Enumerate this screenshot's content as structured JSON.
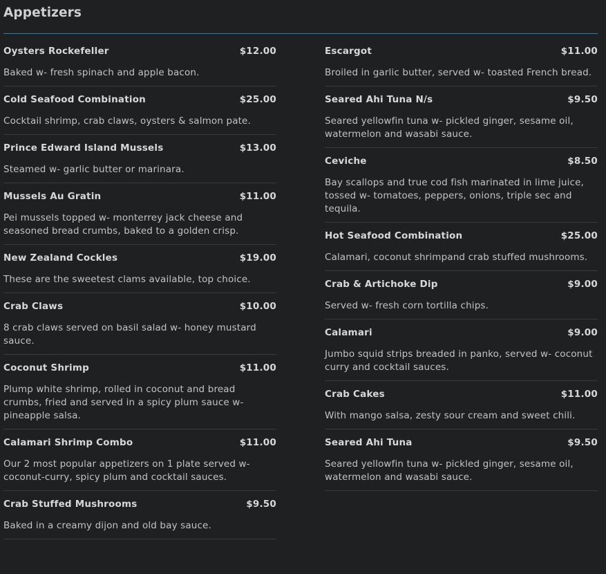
{
  "section": {
    "title": "Appetizers"
  },
  "colors": {
    "background": "#1f2022",
    "accent_rule": "#2f7fb3",
    "text": "#c9c9c9"
  },
  "left_items": [
    {
      "name": "Oysters Rockefeller",
      "price": "$12.00",
      "description": "Baked w- fresh spinach and apple bacon."
    },
    {
      "name": "Cold Seafood Combination",
      "price": "$25.00",
      "description": "Cocktail shrimp, crab claws, oysters & salmon pate."
    },
    {
      "name": "Prince Edward Island Mussels",
      "price": "$13.00",
      "description": "Steamed w- garlic butter or marinara."
    },
    {
      "name": "Mussels Au Gratin",
      "price": "$11.00",
      "description": "Pei mussels topped w- monterrey jack cheese and seasoned bread crumbs, baked to a golden crisp."
    },
    {
      "name": "New Zealand Cockles",
      "price": "$19.00",
      "description": "These are the sweetest clams available, top choice."
    },
    {
      "name": "Crab Claws",
      "price": "$10.00",
      "description": "8 crab claws served on basil salad w- honey mustard sauce."
    },
    {
      "name": "Coconut Shrimp",
      "price": "$11.00",
      "description": "Plump white shrimp, rolled in coconut and bread crumbs, fried and served in a spicy plum sauce w- pineapple salsa."
    },
    {
      "name": "Calamari Shrimp Combo",
      "price": "$11.00",
      "description": "Our 2 most popular appetizers on 1 plate served w- coconut-curry, spicy plum and cocktail sauces."
    },
    {
      "name": "Crab Stuffed Mushrooms",
      "price": "$9.50",
      "description": "Baked in a creamy dijon and old bay sauce."
    }
  ],
  "right_items": [
    {
      "name": "Escargot",
      "price": "$11.00",
      "description": "Broiled in garlic butter, served w- toasted French bread."
    },
    {
      "name": "Seared Ahi Tuna N/s",
      "price": "$9.50",
      "description": "Seared yellowfin tuna w- pickled ginger, sesame oil, watermelon and wasabi sauce."
    },
    {
      "name": "Ceviche",
      "price": "$8.50",
      "description": "Bay scallops and true cod fish marinated in lime juice, tossed w- tomatoes, peppers, onions, triple sec and tequila."
    },
    {
      "name": "Hot Seafood Combination",
      "price": "$25.00",
      "description": "Calamari, coconut shrimpand crab stuffed mushrooms."
    },
    {
      "name": "Crab & Artichoke Dip",
      "price": "$9.00",
      "description": "Served w- fresh corn tortilla chips."
    },
    {
      "name": "Calamari",
      "price": "$9.00",
      "description": "Jumbo squid strips breaded in panko, served w- coconut curry and cocktail sauces."
    },
    {
      "name": "Crab Cakes",
      "price": "$11.00",
      "description": "With mango salsa, zesty sour cream and sweet chili."
    },
    {
      "name": "Seared Ahi Tuna",
      "price": "$9.50",
      "description": "Seared yellowfin tuna w- pickled ginger, sesame oil, watermelon and wasabi sauce."
    }
  ]
}
